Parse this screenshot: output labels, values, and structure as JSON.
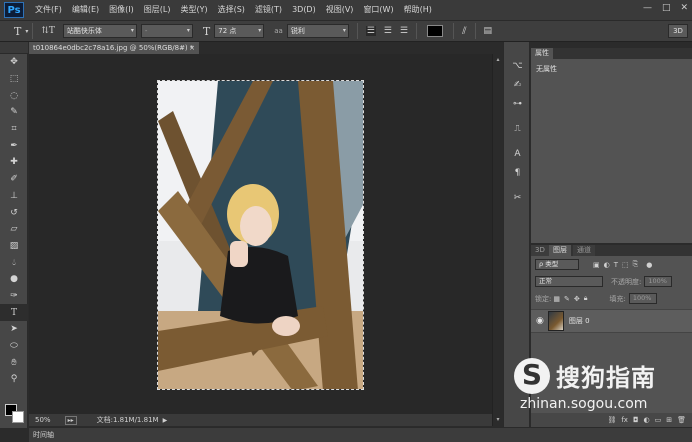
{
  "app": {
    "logo": "Ps"
  },
  "menu": [
    "文件(F)",
    "编辑(E)",
    "图像(I)",
    "图层(L)",
    "类型(Y)",
    "选择(S)",
    "滤镜(T)",
    "3D(D)",
    "视图(V)",
    "窗口(W)",
    "帮助(H)"
  ],
  "window_controls": {
    "minimize": "—",
    "maximize": "□",
    "close": "✕"
  },
  "options_bar": {
    "tool_icon": "T",
    "font_family": "站酷快乐体",
    "font_style": "-",
    "font_size": "72 点",
    "aa_label": "aa",
    "antialias": "锐利",
    "button_3d": "3D"
  },
  "document": {
    "tab_title": "t010864e0dbc2c78a16.jpg @ 50%(RGB/8#) *",
    "tab_close": "×"
  },
  "status": {
    "zoom": "50%",
    "doc_info": "文档:1.81M/1.81M"
  },
  "timeline": {
    "label": "时间轴"
  },
  "properties_panel": {
    "tab": "属性",
    "body": "无属性"
  },
  "layers_panel": {
    "tabs": [
      "3D",
      "图层",
      "通道"
    ],
    "filter_kind": "ρ 类型",
    "blend_mode": "正常",
    "opacity_label": "不透明度:",
    "opacity_value": "100%",
    "lock_label": "锁定:",
    "fill_label": "填充:",
    "fill_value": "100%",
    "layer_name": "图层 0"
  },
  "watermark": {
    "text": "搜狗指南",
    "url": "zhinan.sogou.com"
  },
  "colors": {
    "fg": "#000000",
    "bg": "#ffffff",
    "brand_blue": "#31a8ff"
  }
}
